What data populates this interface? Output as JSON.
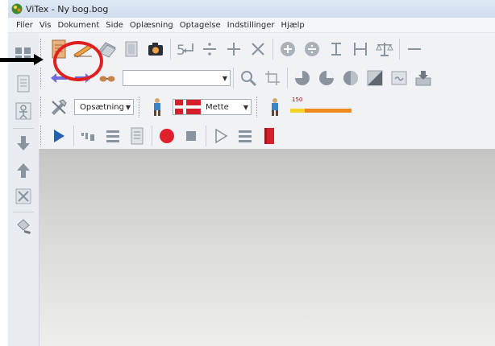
{
  "window": {
    "title": "ViTex - Ny bog.bog"
  },
  "menu": [
    {
      "label": "Filer"
    },
    {
      "label": "Vis"
    },
    {
      "label": "Dokument"
    },
    {
      "label": "Side"
    },
    {
      "label": "Oplæsning"
    },
    {
      "label": "Optagelse"
    },
    {
      "label": "Indstillinger"
    },
    {
      "label": "Hjælp"
    }
  ],
  "toolbar_row3": {
    "setup_combo": "Opsætning",
    "voice_combo": "Mette",
    "level_value": "150"
  },
  "toolbar_row2": {
    "page_combo": ""
  },
  "colors": {
    "annotation_circle": "#e02020",
    "record_red": "#e0202c",
    "play_blue": "#1f5fb5",
    "flag_red": "#d3202a"
  }
}
